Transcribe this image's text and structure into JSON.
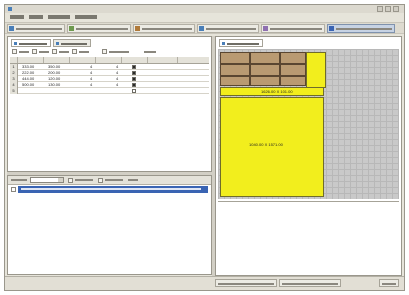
{
  "window": {
    "title": ""
  },
  "table": {
    "rows": [
      {
        "num": "1",
        "length": "333.00",
        "width": "350.00",
        "qty": "4",
        "checked": true
      },
      {
        "num": "2",
        "length": "222.00",
        "width": "200.00",
        "qty": "4",
        "checked": true
      },
      {
        "num": "3",
        "length": "444.00",
        "width": "120.00",
        "qty": "4",
        "checked": true
      },
      {
        "num": "4",
        "length": "500.00",
        "width": "130.00",
        "qty": "4",
        "checked": true
      },
      {
        "num": "5",
        "length": "",
        "width": "",
        "qty": "",
        "checked": false
      }
    ]
  },
  "layout_view": {
    "strip_dims": "1626.00 X 101.00",
    "sheet_dims": "1040.00 X 1571.00"
  },
  "colors": {
    "selection": "#3a64b3",
    "sheet": "#f2ee1d",
    "parts": "#b99a72",
    "active_tab": "#c7d3e4"
  }
}
